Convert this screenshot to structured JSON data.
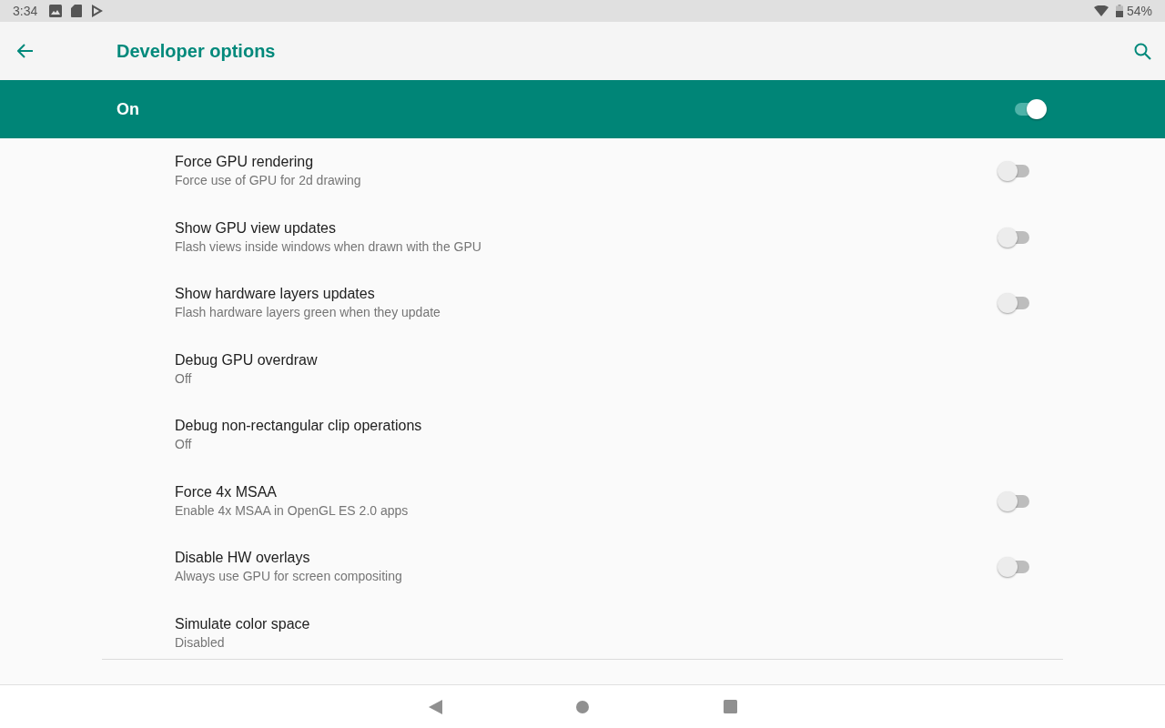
{
  "status_bar": {
    "time": "3:34",
    "battery": "54%"
  },
  "app_bar": {
    "title": "Developer options"
  },
  "master_switch": {
    "label": "On",
    "on": true
  },
  "settings": [
    {
      "kind": "switch",
      "title": "Force GPU rendering",
      "summary": "Force use of GPU for 2d drawing",
      "on": false
    },
    {
      "kind": "switch",
      "title": "Show GPU view updates",
      "summary": "Flash views inside windows when drawn with the GPU",
      "on": false
    },
    {
      "kind": "switch",
      "title": "Show hardware layers updates",
      "summary": "Flash hardware layers green when they update",
      "on": false
    },
    {
      "kind": "list",
      "title": "Debug GPU overdraw",
      "summary": "Off"
    },
    {
      "kind": "list",
      "title": "Debug non-rectangular clip operations",
      "summary": "Off"
    },
    {
      "kind": "switch",
      "title": "Force 4x MSAA",
      "summary": "Enable 4x MSAA in OpenGL ES 2.0 apps",
      "on": false
    },
    {
      "kind": "switch",
      "title": "Disable HW overlays",
      "summary": "Always use GPU for screen compositing",
      "on": false
    },
    {
      "kind": "list",
      "title": "Simulate color space",
      "summary": "Disabled"
    }
  ]
}
